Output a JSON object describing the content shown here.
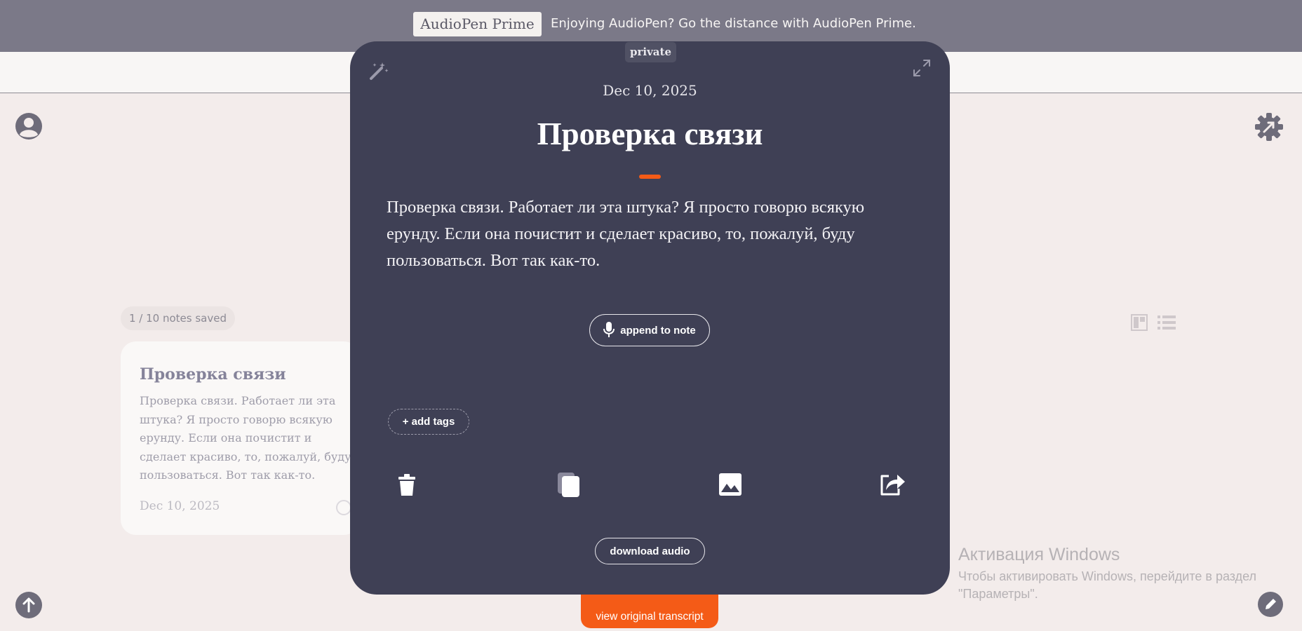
{
  "banner": {
    "badge": "AudioPen Prime",
    "message": "Enjoying AudioPen? Go the distance with AudioPen Prime."
  },
  "header": {
    "profile_icon": "user-circle-icon",
    "settings_icon": "gear-icon"
  },
  "notes": {
    "count_label": "1 / 10 notes saved",
    "views": [
      "grid-view-icon",
      "list-view-icon"
    ],
    "items": [
      {
        "title": "Проверка связи",
        "body": "Проверка связи. Работает ли эта штука? Я просто говорю всякую ерунду. Если она почистит и сделает красиво, то, пожалуй, буду пользоваться. Вот так как-то.",
        "date": "Dec 10, 2025"
      }
    ]
  },
  "modal": {
    "privacy": "private",
    "date": "Dec 10, 2025",
    "title": "Проверка связи",
    "body": "Проверка связи. Работает ли эта штука? Я просто говорю всякую ерунду. Если она почистит и сделает красиво, то, пожалуй, буду пользоваться. Вот так как-то.",
    "append_label": "append to note",
    "add_tags_label": "+ add tags",
    "download_label": "download audio",
    "actions": [
      "trash-icon",
      "copy-icon",
      "image-icon",
      "share-icon"
    ],
    "accent_color": "#f45b17"
  },
  "footer": {
    "transcript_label": "view original transcript"
  },
  "windows_watermark": {
    "title": "Активация Windows",
    "subtitle": "Чтобы активировать Windows, перейдите в раздел \"Параметры\"."
  }
}
